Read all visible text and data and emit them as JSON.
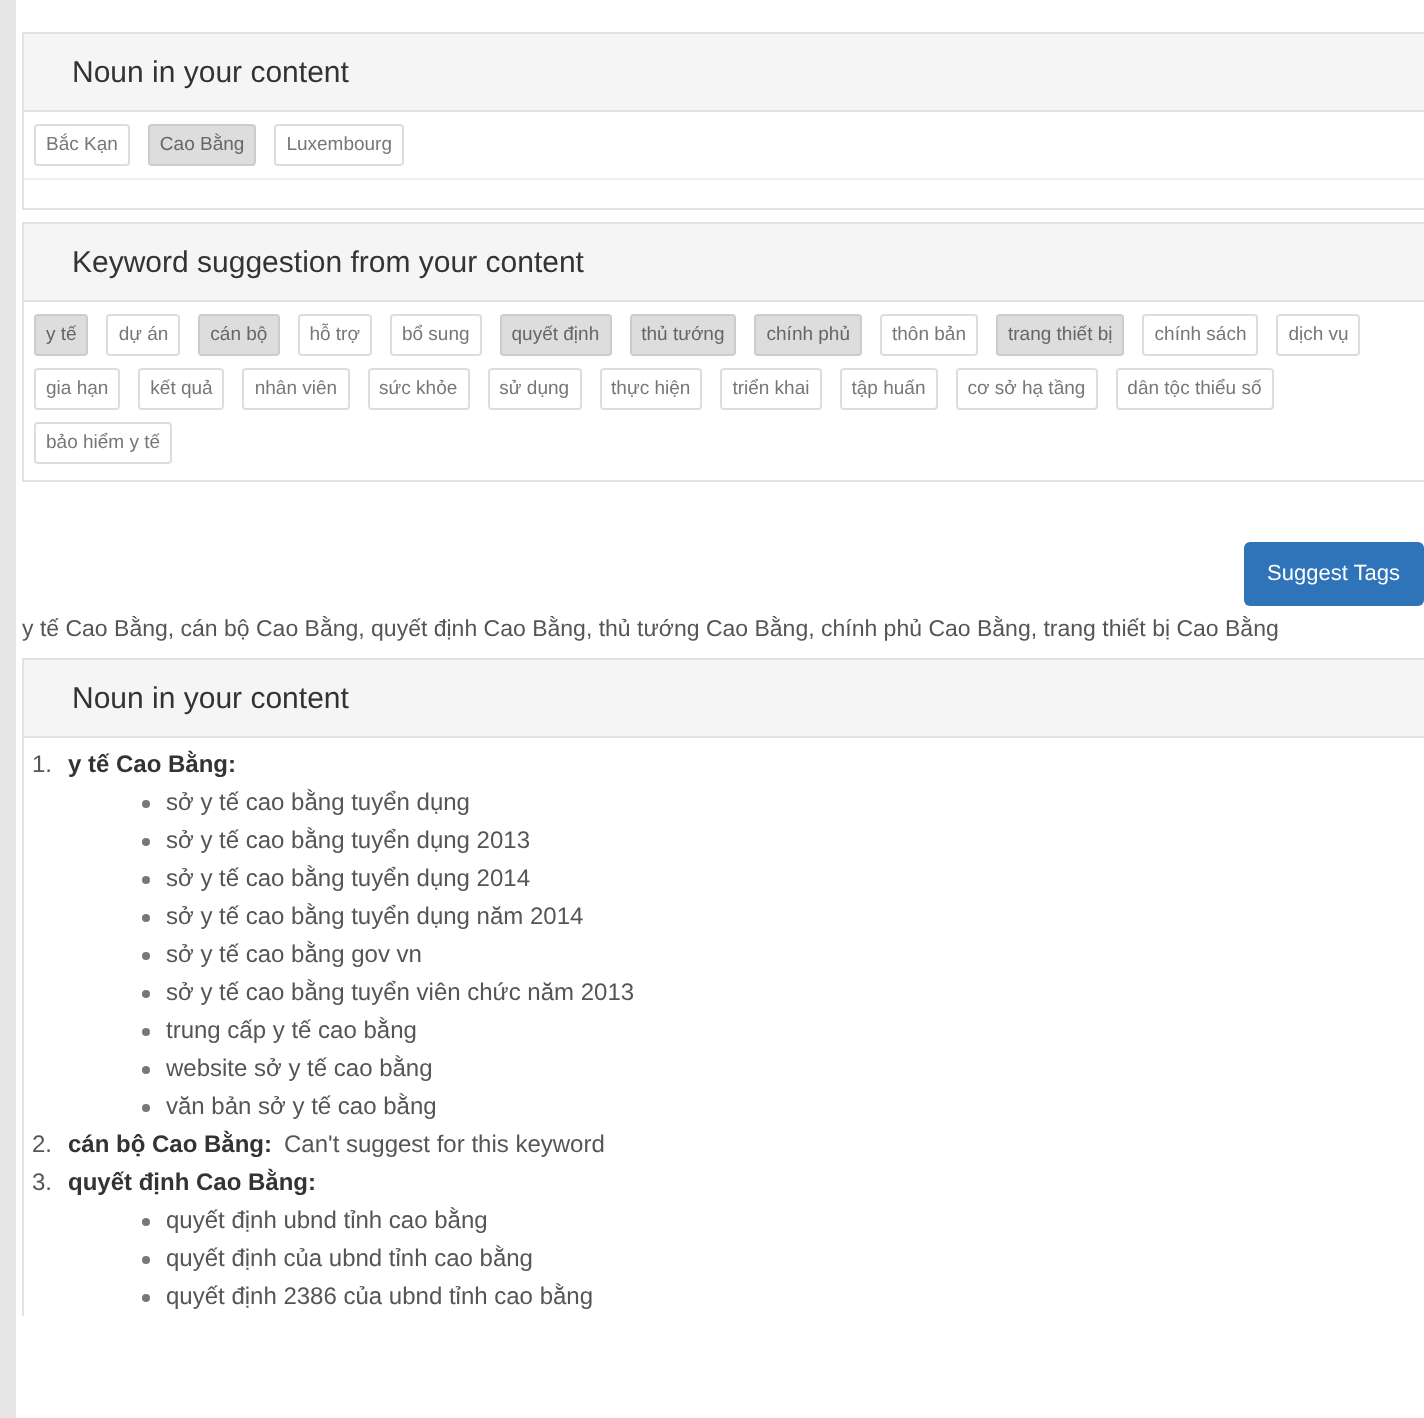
{
  "noun_panel": {
    "title": "Noun in your content",
    "tags": [
      {
        "label": "Bắc Kạn",
        "selected": false
      },
      {
        "label": "Cao Bằng",
        "selected": true
      },
      {
        "label": "Luxembourg",
        "selected": false
      }
    ]
  },
  "keyword_panel": {
    "title": "Keyword suggestion from your content",
    "tags": [
      {
        "label": "y tế",
        "selected": true
      },
      {
        "label": "dự án",
        "selected": false
      },
      {
        "label": "cán bộ",
        "selected": true
      },
      {
        "label": "hỗ trợ",
        "selected": false
      },
      {
        "label": "bổ sung",
        "selected": false
      },
      {
        "label": "quyết định",
        "selected": true
      },
      {
        "label": "thủ tướng",
        "selected": true
      },
      {
        "label": "chính phủ",
        "selected": true
      },
      {
        "label": "thôn bản",
        "selected": false
      },
      {
        "label": "trang thiết bị",
        "selected": true
      },
      {
        "label": "chính sách",
        "selected": false
      },
      {
        "label": "dịch vụ",
        "selected": false
      },
      {
        "label": "gia hạn",
        "selected": false
      },
      {
        "label": "kết quả",
        "selected": false
      },
      {
        "label": "nhân viên",
        "selected": false
      },
      {
        "label": "sức khỏe",
        "selected": false
      },
      {
        "label": "sử dụng",
        "selected": false
      },
      {
        "label": "thực hiện",
        "selected": false
      },
      {
        "label": "triển khai",
        "selected": false
      },
      {
        "label": "tập huấn",
        "selected": false
      },
      {
        "label": "cơ sở hạ tầng",
        "selected": false
      },
      {
        "label": "dân tộc thiểu số",
        "selected": false
      },
      {
        "label": "bảo hiểm y tế",
        "selected": false
      }
    ]
  },
  "suggest_button": "Suggest Tags",
  "result_text": "y tế Cao Bằng, cán bộ Cao Bằng, quyết định Cao Bằng, thủ tướng Cao Bằng, chính phủ Cao Bằng, trang thiết bị Cao Bằng",
  "results_panel": {
    "title": "Noun in your content",
    "items": [
      {
        "number": "1.",
        "keyword": "y tế Cao Bằng:",
        "suggestions": [
          "sở y tế cao bằng tuyển dụng",
          "sở y tế cao bằng tuyển dụng 2013",
          "sở y tế cao bằng tuyển dụng 2014",
          "sở y tế cao bằng tuyển dụng năm 2014",
          "sở y tế cao bằng gov vn",
          "sở y tế cao bằng tuyển viên chức năm 2013",
          "trung cấp y tế cao bằng",
          "website sở y tế cao bằng",
          "văn bản sở y tế cao bằng"
        ]
      },
      {
        "number": "2.",
        "keyword": "cán bộ Cao Bằng:",
        "note": "Can't suggest for this keyword"
      },
      {
        "number": "3.",
        "keyword": "quyết định Cao Bằng:",
        "suggestions": [
          "quyết định ubnd tỉnh cao bằng",
          "quyết định của ubnd tỉnh cao bằng",
          "quyết định 2386 của ubnd tỉnh cao bằng"
        ]
      }
    ]
  }
}
